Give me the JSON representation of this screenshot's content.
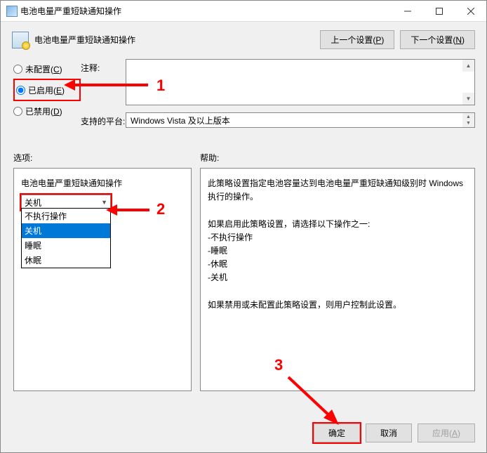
{
  "window": {
    "title": "电池电量严重短缺通知操作"
  },
  "header": {
    "title": "电池电量严重短缺通知操作",
    "prev_btn": "上一个设置(",
    "prev_key": "P",
    "next_btn": "下一个设置(",
    "next_key": "N",
    "btn_close": ")"
  },
  "radios": {
    "not_configured": "未配置(",
    "not_configured_key": "C",
    "enabled": "已启用(",
    "enabled_key": "E",
    "disabled": "已禁用(",
    "disabled_key": "D",
    "close": ")"
  },
  "fields": {
    "comment_label": "注释:",
    "platform_label": "支持的平台:",
    "platform_value": "Windows Vista 及以上版本"
  },
  "mid": {
    "options_label": "选项:",
    "help_label": "帮助:"
  },
  "options": {
    "title": "电池电量严重短缺通知操作",
    "selected": "关机",
    "items": [
      "不执行操作",
      "关机",
      "睡眠",
      "休眠"
    ]
  },
  "help": {
    "p1": "此策略设置指定电池容量达到电池电量严重短缺通知级别时 Windows 执行的操作。",
    "p2": "如果启用此策略设置，请选择以下操作之一:",
    "l1": "-不执行操作",
    "l2": "-睡眠",
    "l3": "-休眠",
    "l4": "-关机",
    "p3": "如果禁用或未配置此策略设置，则用户控制此设置。"
  },
  "footer": {
    "ok": "确定",
    "cancel": "取消",
    "apply": "应用(",
    "apply_key": "A",
    "close": ")"
  },
  "annotations": {
    "n1": "1",
    "n2": "2",
    "n3": "3"
  }
}
